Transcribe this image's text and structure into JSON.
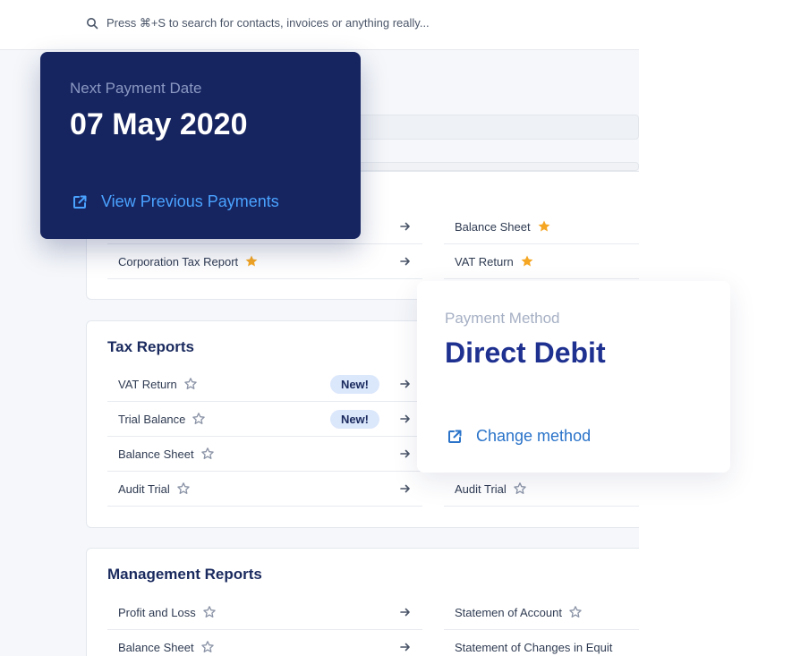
{
  "search": {
    "placeholder": "Press ⌘+S to search for contacts, invoices or anything really..."
  },
  "first_section": {
    "left_rows": [
      {
        "label": "",
        "starred": false
      },
      {
        "label": "Corporation Tax Report",
        "starred": true
      }
    ],
    "right_rows": [
      {
        "label": "Balance Sheet",
        "starred": true
      },
      {
        "label": "VAT Return",
        "starred": true
      }
    ]
  },
  "tax_reports": {
    "title": "Tax Reports",
    "left_rows": [
      {
        "label": "VAT Return",
        "starred": false,
        "badge": "New!"
      },
      {
        "label": "Trial Balance",
        "starred": false,
        "badge": "New!"
      },
      {
        "label": "Balance Sheet",
        "starred": false
      },
      {
        "label": "Audit Trial",
        "starred": false
      }
    ],
    "right_rows": [
      {
        "label": "Audit Trial",
        "starred": false
      }
    ]
  },
  "management_reports": {
    "title": "Management Reports",
    "left_rows": [
      {
        "label": "Profit and Loss",
        "starred": false
      },
      {
        "label": "Balance Sheet",
        "starred": false
      }
    ],
    "right_rows": [
      {
        "label": "Statemen of Account",
        "starred": false
      },
      {
        "label": "Statement of Changes in Equit",
        "starred": false
      }
    ]
  },
  "payment_card": {
    "label": "Next Payment Date",
    "date": "07 May 2020",
    "link": "View Previous Payments"
  },
  "method_card": {
    "label": "Payment Method",
    "value": "Direct Debit",
    "link": "Change method"
  },
  "colors": {
    "navy": "#162460",
    "accent_blue": "#4aa3ff",
    "link_blue": "#2a73c9",
    "star_gold": "#f5a623",
    "badge_bg": "#dbe7fb"
  }
}
